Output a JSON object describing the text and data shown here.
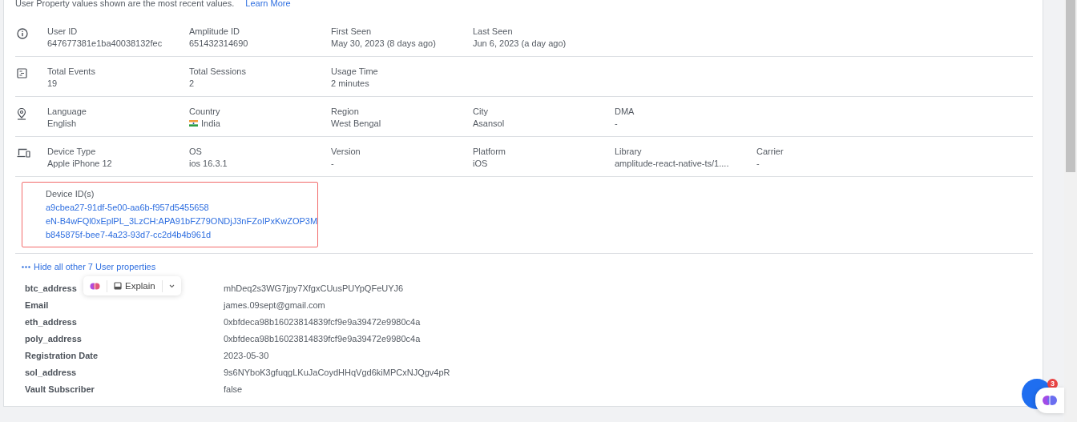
{
  "notice": {
    "text": "User Property values shown are the most recent values.",
    "link": "Learn More"
  },
  "sections": [
    {
      "fields": [
        {
          "kind": "text",
          "label": "User ID",
          "value": "647677381e1ba40038132fec"
        },
        {
          "kind": "text",
          "label": "Amplitude ID",
          "value": "651432314690"
        },
        {
          "kind": "text",
          "label": "First Seen",
          "value": "May 30, 2023 (8 days ago)"
        },
        {
          "kind": "text",
          "label": "Last Seen",
          "value": "Jun 6, 2023 (a day ago)"
        }
      ]
    },
    {
      "fields": [
        {
          "kind": "text",
          "label": "Total Events",
          "value": "19"
        },
        {
          "kind": "text",
          "label": "Total Sessions",
          "value": "2"
        },
        {
          "kind": "text",
          "label": "Usage Time",
          "value": "2 minutes"
        }
      ]
    },
    {
      "fields": [
        {
          "kind": "text",
          "label": "Language",
          "value": "English"
        },
        {
          "kind": "flag",
          "label": "Country",
          "value": "India"
        },
        {
          "kind": "text",
          "label": "Region",
          "value": "West Bengal"
        },
        {
          "kind": "text",
          "label": "City",
          "value": "Asansol"
        },
        {
          "kind": "text",
          "label": "DMA",
          "value": "-"
        }
      ]
    },
    {
      "fields": [
        {
          "kind": "text",
          "label": "Device Type",
          "value": "Apple iPhone 12"
        },
        {
          "kind": "text",
          "label": "OS",
          "value": "ios 16.3.1"
        },
        {
          "kind": "text",
          "label": "Version",
          "value": "-"
        },
        {
          "kind": "text",
          "label": "Platform",
          "value": "iOS"
        },
        {
          "kind": "text",
          "label": "Library",
          "value": "amplitude-react-native-ts/1...."
        },
        {
          "kind": "text",
          "label": "Carrier",
          "value": "-"
        }
      ]
    }
  ],
  "device_ids": {
    "label": "Device ID(s)",
    "ids": [
      "a9cbea27-91df-5e00-aa6b-f957d5455658",
      "eN-B4wFQl0xEplPL_3LzCH:APA91bFZ79ONDjJ3nFZoIPxKwZOP3M",
      "b845875f-bee7-4a23-93d7-cc2d4b4b961d"
    ]
  },
  "toggle_link": "Hide all other 7 User properties",
  "properties": [
    {
      "name": "btc_address",
      "value": "mhDeq2s3WG7jpy7XfgxCUusPUYpQFeUYJ6"
    },
    {
      "name": "Email",
      "value": "james.09sept@gmail.com"
    },
    {
      "name": "eth_address",
      "value": "0xbfdeca98b16023814839fcf9e9a39472e9980c4a"
    },
    {
      "name": "poly_address",
      "value": "0xbfdeca98b16023814839fcf9e9a39472e9980c4a"
    },
    {
      "name": "Registration Date",
      "value": "2023-05-30"
    },
    {
      "name": "sol_address",
      "value": "9s6NYboK3gfuqgLKuJaCoydHHqVgd6kiMPCxNJQgv4pR"
    },
    {
      "name": "Vault Subscriber",
      "value": "false"
    }
  ],
  "explain_popup": {
    "label": "Explain"
  },
  "chat": {
    "badge": "3"
  }
}
